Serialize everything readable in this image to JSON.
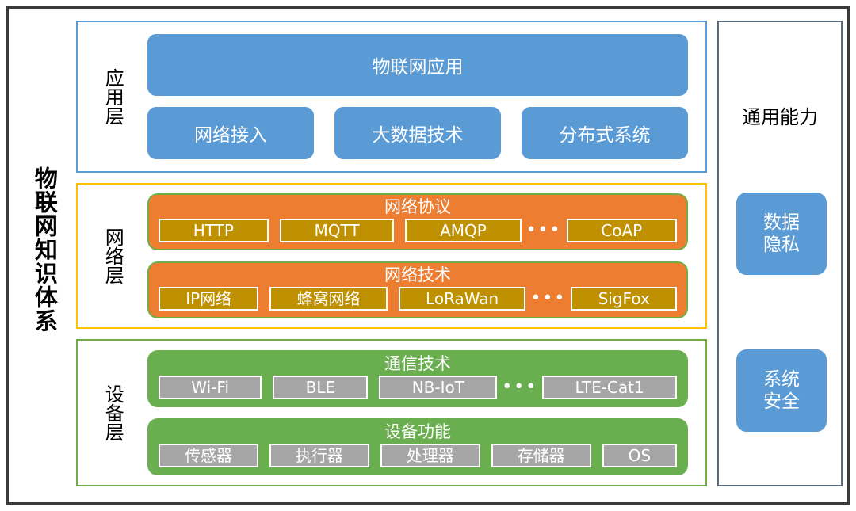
{
  "diagram": {
    "main_title": "物联网知识体系"
  },
  "layers": [
    {
      "id": "application",
      "label": "应用层",
      "border_color": "#5B9BD5",
      "hero": "物联网应用",
      "cells": [
        "网络接入",
        "大数据技术",
        "分布式系统"
      ]
    },
    {
      "id": "network",
      "label": "网络层",
      "border_color": "#FFC000",
      "bars": [
        {
          "title": "网络协议",
          "fill": "#ED7D31",
          "chip_fill": "#BF9000",
          "chips": [
            "HTTP",
            "MQTT",
            "AMQP"
          ],
          "ellipsis": "•••",
          "tail_chip": "CoAP"
        },
        {
          "title": "网络技术",
          "fill": "#ED7D31",
          "chip_fill": "#BF9000",
          "chips": [
            "IP网络",
            "蜂窝网络",
            "LoRaWan"
          ],
          "ellipsis": "•••",
          "tail_chip": "SigFox"
        }
      ]
    },
    {
      "id": "device",
      "label": "设备层",
      "border_color": "#70AD47",
      "bars": [
        {
          "title": "通信技术",
          "fill": "#6AAF4F",
          "chip_fill": "#A6A6A6",
          "chips": [
            "Wi-Fi",
            "BLE",
            "NB-IoT"
          ],
          "ellipsis": "•••",
          "tail_chip": "LTE-Cat1"
        },
        {
          "title": "设备功能",
          "fill": "#6AAF4F",
          "chip_fill": "#A6A6A6",
          "chips": [
            "传感器",
            "执行器",
            "处理器",
            "存储器",
            "OS"
          ],
          "ellipsis": "",
          "tail_chip": ""
        }
      ]
    }
  ],
  "capabilities": {
    "title": "通用能力",
    "items": [
      {
        "line1": "数据",
        "line2": "隐私"
      },
      {
        "line1": "系统",
        "line2": "安全"
      }
    ]
  }
}
